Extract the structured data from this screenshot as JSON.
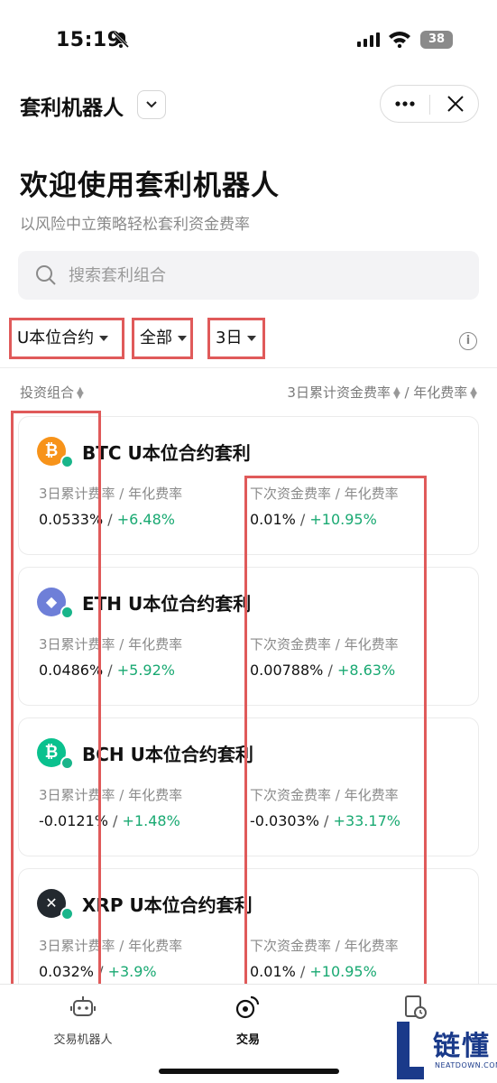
{
  "status_bar": {
    "time": "15:19",
    "battery": "38"
  },
  "header": {
    "title": "套利机器人"
  },
  "hero": {
    "title": "欢迎使用套利机器人",
    "subtitle": "以风险中立策略轻松套利资金费率"
  },
  "search": {
    "placeholder": "搜索套利组合"
  },
  "filters": {
    "contract_type": "U本位合约",
    "scope": "全部",
    "period": "3日"
  },
  "columns": {
    "left": "投资组合",
    "right_a": "3日累计资金费率",
    "right_b": "年化费率"
  },
  "colors": {
    "accent_green": "#19a972",
    "highlight_red": "#e05a5a"
  },
  "cards": [
    {
      "name": "BTC U本位合约套利",
      "coin_icon": "bitcoin-icon",
      "coin_color": "#f7931a",
      "coin_glyph": "₿",
      "left_label": "3日累计费率 / 年化费率",
      "left_rate": "0.0533%",
      "left_annual": "+6.48%",
      "right_label": "下次资金费率 / 年化费率",
      "right_rate": "0.01%",
      "right_annual": "+10.95%"
    },
    {
      "name": "ETH U本位合约套利",
      "coin_icon": "ethereum-icon",
      "coin_color": "#6e7fd8",
      "coin_glyph": "◆",
      "left_label": "3日累计费率 / 年化费率",
      "left_rate": "0.0486%",
      "left_annual": "+5.92%",
      "right_label": "下次资金费率 / 年化费率",
      "right_rate": "0.00788%",
      "right_annual": "+8.63%"
    },
    {
      "name": "BCH U本位合约套利",
      "coin_icon": "bitcoin-cash-icon",
      "coin_color": "#0ac18e",
      "coin_glyph": "₿",
      "left_label": "3日累计费率 / 年化费率",
      "left_rate": "-0.0121%",
      "left_annual": "+1.48%",
      "right_label": "下次资金费率 / 年化费率",
      "right_rate": "-0.0303%",
      "right_annual": "+33.17%"
    },
    {
      "name": "XRP U本位合约套利",
      "coin_icon": "xrp-icon",
      "coin_color": "#23292f",
      "coin_glyph": "✕",
      "left_label": "3日累计费率 / 年化费率",
      "left_rate": "0.032%",
      "left_annual": "+3.9%",
      "right_label": "下次资金费率 / 年化费率",
      "right_rate": "0.01%",
      "right_annual": "+10.95%"
    }
  ],
  "tabs": [
    {
      "label": "交易机器人",
      "icon": "robot-icon"
    },
    {
      "label": "交易",
      "icon": "trade-icon"
    },
    {
      "label": "",
      "icon": "history-icon"
    }
  ],
  "watermark": {
    "text": "链懂",
    "sub": "NEATDOWN.COM"
  }
}
